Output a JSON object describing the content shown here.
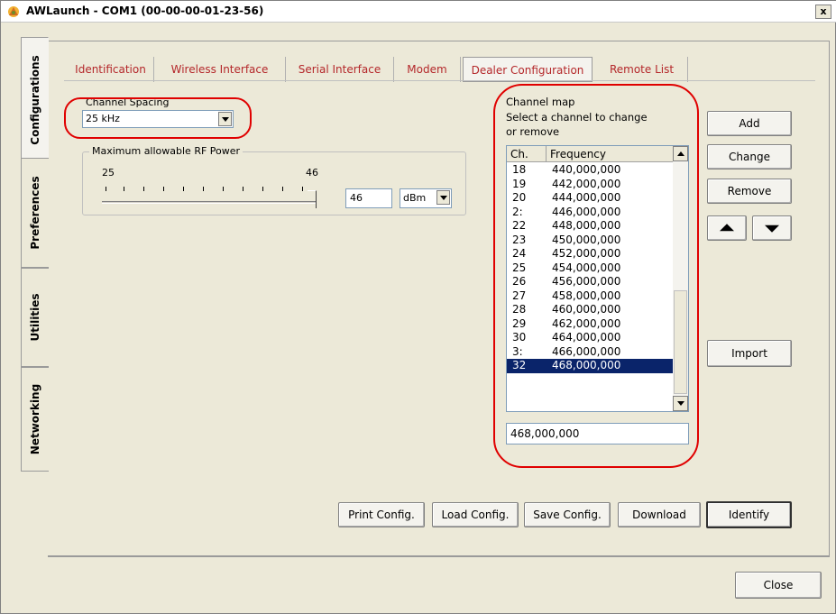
{
  "window": {
    "title": "AWLaunch - COM1  (00-00-00-01-23-56)",
    "close_glyph": "x"
  },
  "side_tabs": [
    {
      "label": "Configurations",
      "active": true
    },
    {
      "label": "Preferences"
    },
    {
      "label": "Utilities"
    },
    {
      "label": "Networking"
    }
  ],
  "tabs": [
    {
      "label": "Identification"
    },
    {
      "label": "Wireless Interface"
    },
    {
      "label": "Serial Interface"
    },
    {
      "label": "Modem"
    },
    {
      "label": "Dealer Configuration",
      "active": true
    },
    {
      "label": "Remote List"
    }
  ],
  "channel_spacing": {
    "label": "Channel Spacing",
    "value": "25 kHz"
  },
  "rf_power": {
    "group_title": "Maximum allowable RF Power",
    "min_label": "25",
    "max_label": "46",
    "value": "46",
    "unit": "dBm",
    "slider_level": 1.0
  },
  "channel_map": {
    "label_line1": "Channel map",
    "label_line2": "Select a channel to change",
    "label_line3": "or remove",
    "col_ch": "Ch.",
    "col_freq": "Frequency",
    "rows": [
      {
        "ch": "18",
        "freq": "440,000,000"
      },
      {
        "ch": "19",
        "freq": "442,000,000"
      },
      {
        "ch": "20",
        "freq": "444,000,000"
      },
      {
        "ch": "2:",
        "freq": "446,000,000"
      },
      {
        "ch": "22",
        "freq": "448,000,000"
      },
      {
        "ch": "23",
        "freq": "450,000,000"
      },
      {
        "ch": "24",
        "freq": "452,000,000"
      },
      {
        "ch": "25",
        "freq": "454,000,000"
      },
      {
        "ch": "26",
        "freq": "456,000,000"
      },
      {
        "ch": "27",
        "freq": "458,000,000"
      },
      {
        "ch": "28",
        "freq": "460,000,000"
      },
      {
        "ch": "29",
        "freq": "462,000,000"
      },
      {
        "ch": "30",
        "freq": "464,000,000"
      },
      {
        "ch": "3:",
        "freq": "466,000,000"
      },
      {
        "ch": "32",
        "freq": "468,000,000",
        "selected": true
      }
    ],
    "edit_value": "468,000,000"
  },
  "side_buttons": {
    "add": "Add",
    "change": "Change",
    "remove": "Remove",
    "import": "Import"
  },
  "bottom_buttons": {
    "print": "Print Config.",
    "load": "Load Config.",
    "save": "Save Config.",
    "download": "Download",
    "identify": "Identify"
  },
  "close_button": "Close",
  "colors": {
    "tab_text": "#b4272a",
    "highlight": "#e00000",
    "selection": "#0a246a"
  }
}
